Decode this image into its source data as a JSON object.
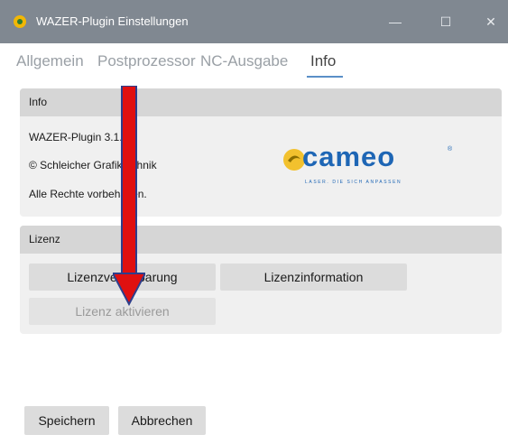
{
  "window": {
    "title": "WAZER-Plugin  Einstellungen",
    "controls": {
      "minimize": "—",
      "maximize": "☐",
      "close": "✕"
    }
  },
  "tabs": [
    {
      "label": "Allgemein",
      "active": false
    },
    {
      "label": "Postprozessor",
      "active": false
    },
    {
      "label": "NC-Ausgabe",
      "active": false
    },
    {
      "label": "Info",
      "active": true
    }
  ],
  "info_panel": {
    "header": "Info",
    "lines": [
      "WAZER-Plugin  3.1.2",
      "© Schleicher Grafiktechnik",
      "Alle Rechte vorbehalten."
    ]
  },
  "logo": {
    "text": "cameo",
    "tagline": "LASER. DIE SICH ANPASSEN",
    "registered": "®",
    "color": "#1e66b5"
  },
  "license_panel": {
    "header": "Lizenz",
    "buttons": {
      "agreement": "Lizenzvereinbarung",
      "information": "Lizenzinformation",
      "activate": "Lizenz aktivieren"
    }
  },
  "footer": {
    "save": "Speichern",
    "cancel": "Abbrechen"
  },
  "colors": {
    "titlebar": "#808891",
    "accent": "#5a8fc7",
    "annotation_arrow": "#e01010"
  }
}
